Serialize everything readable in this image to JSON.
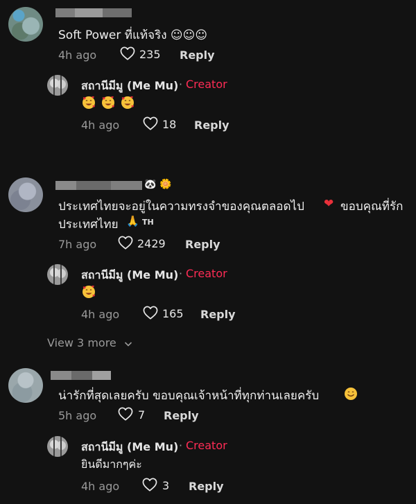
{
  "comments": [
    {
      "text": "Soft Power ที่แท้จริง ☺☺☺",
      "time": "4h ago",
      "likes": "235",
      "reply_label": "Reply",
      "reply": {
        "author": "สถานีมีมู (Me Mu)",
        "separator": "·",
        "creator_tag": "Creator",
        "text": "",
        "emojis": [
          "smiling-hearts",
          "smiling-hearts",
          "smiling-hearts"
        ],
        "time": "4h ago",
        "likes": "18",
        "reply_label": "Reply"
      }
    },
    {
      "text_line1": "ประเทศไทยจะอยู่ในความทรงจำของคุณตลอดไป",
      "heart_emoji": "❤",
      "text_line1_tail": "ขอบคุณที่รัก",
      "text_line2": "ประเทศไทย",
      "pray_emoji": "🙏",
      "flag_text": "TH",
      "name_emojis": [
        "🐼",
        "🌼"
      ],
      "time": "7h ago",
      "likes": "2429",
      "reply_label": "Reply",
      "reply": {
        "author": "สถานีมีมู (Me Mu)",
        "separator": "·",
        "creator_tag": "Creator",
        "emojis": [
          "smiling-hearts"
        ],
        "time": "4h ago",
        "likes": "165",
        "reply_label": "Reply"
      },
      "view_more": "View 3 more"
    },
    {
      "text": "น่ารักที่สุดเลยครับ ขอบคุณเจ้าหน้าที่ทุกท่านเลยครับ",
      "emoji": "smiling",
      "time": "5h ago",
      "likes": "7",
      "reply_label": "Reply",
      "reply": {
        "author": "สถานีมีมู (Me Mu)",
        "separator": "·",
        "creator_tag": "Creator",
        "text": "ยินดีมากๆค่ะ",
        "time": "4h ago",
        "likes": "3",
        "reply_label": "Reply"
      }
    }
  ],
  "colors": {
    "background": "#121212",
    "creator": "#fe2c55",
    "muted": "#9a9a9a"
  }
}
